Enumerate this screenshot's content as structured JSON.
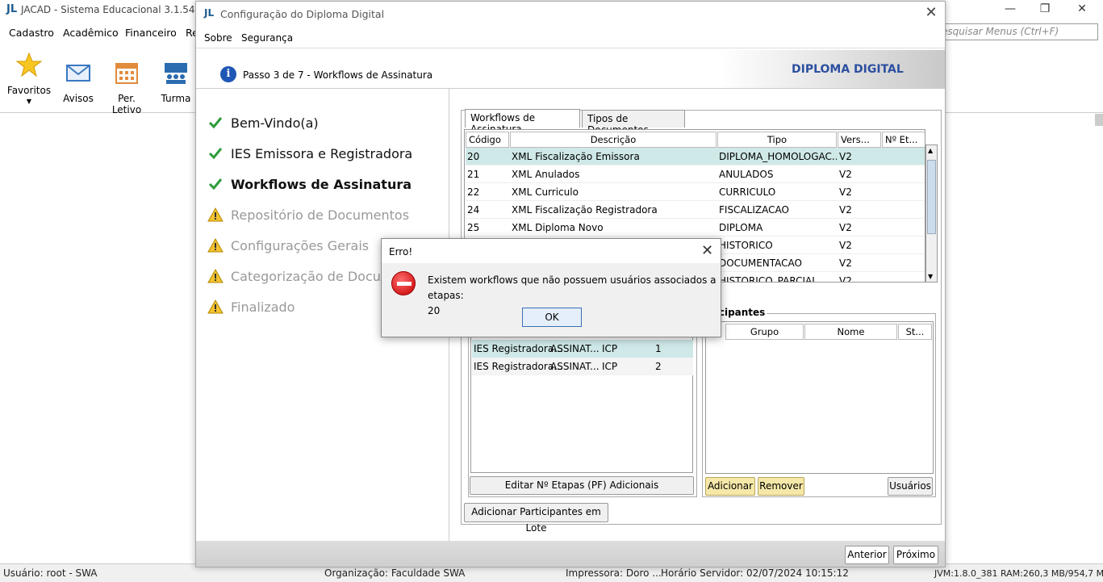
{
  "app": {
    "title": "JACAD - Sistema Educacional 3.1.54",
    "logo": "JL",
    "menu": [
      "Cadastro",
      "Acadêmico",
      "Financeiro",
      "Re"
    ],
    "search_placeholder": "esquisar Menus (Ctrl+F)",
    "toolbar": [
      {
        "label": "Favoritos",
        "icon": "star-icon"
      },
      {
        "label": "Avisos",
        "icon": "mail-icon"
      },
      {
        "label": "Per. Letivo",
        "icon": "calendar-icon"
      },
      {
        "label": "Turma",
        "icon": "class-icon"
      }
    ],
    "window_controls": {
      "minimize": "—",
      "maximize": "❐",
      "close": "✕"
    }
  },
  "status": {
    "user": "Usuário: root - SWA",
    "org": "Organização: Faculdade SWA",
    "printer": "Impressora: Doro ...",
    "server_time": "Horário Servidor: 02/07/2024 10:15:12",
    "jvm": "JVM:1.8.0_381  RAM:260,3 MB/954,7 MB"
  },
  "dialog": {
    "title": "Configuração do Diploma Digital",
    "logo": "JL",
    "close": "✕",
    "menu": [
      "Sobre",
      "Segurança"
    ],
    "step_text": "Passo 3 de 7 - Workflows de Assinatura",
    "brand": "DIPLOMA DIGITAL",
    "steps": [
      {
        "label": "Bem-Vindo(a)",
        "state": "done"
      },
      {
        "label": "IES Emissora e Registradora",
        "state": "done"
      },
      {
        "label": "Workflows de Assinatura",
        "state": "current"
      },
      {
        "label": "Repositório de Documentos",
        "state": "pending"
      },
      {
        "label": "Configurações Gerais",
        "state": "pending"
      },
      {
        "label": "Categorização de Docume",
        "state": "pending"
      },
      {
        "label": "Finalizado",
        "state": "pending"
      }
    ],
    "tabs": [
      "Workflows de Assinatura",
      "Tipos de Documentos"
    ],
    "workflow_grid": {
      "columns": [
        "Código",
        "Descrição",
        "Tipo",
        "Vers...",
        "Nº Et..."
      ],
      "rows": [
        [
          "20",
          "XML Fiscalização Emissora",
          "DIPLOMA_HOMOLOGAC...",
          "V2",
          ""
        ],
        [
          "21",
          "XML Anulados",
          "ANULADOS",
          "V2",
          ""
        ],
        [
          "22",
          "XML Curriculo",
          "CURRICULO",
          "V2",
          ""
        ],
        [
          "24",
          "XML Fiscalização Registradora",
          "FISCALIZACAO",
          "V2",
          ""
        ],
        [
          "25",
          "XML Diploma Novo",
          "DIPLOMA",
          "V2",
          ""
        ],
        [
          "",
          "",
          "HISTORICO",
          "V2",
          ""
        ],
        [
          "",
          "",
          "DOCUMENTACAO",
          "V2",
          ""
        ],
        [
          "",
          "",
          "HISTORICO_PARCIAL",
          "V2",
          ""
        ]
      ]
    },
    "steps_grid_rows": [
      [
        "IES Registradora...",
        "ASSINAT...",
        "ICP",
        "1"
      ],
      [
        "IES Registradora...",
        "ASSINAT...",
        "ICP",
        "2"
      ]
    ],
    "participants": {
      "legend": "ticipantes",
      "columns": [
        "Grupo",
        "Nome",
        "St..."
      ]
    },
    "buttons": {
      "edit_steps": "Editar Nº Etapas (PF) Adicionais",
      "add": "Adicionar",
      "remove": "Remover",
      "users": "Usuários",
      "add_batch": "Adicionar Participantes em Lote",
      "prev": "Anterior",
      "next": "Próximo"
    }
  },
  "error": {
    "title": "Erro!",
    "close": "✕",
    "message": "Existem workflows que não possuem usuários associados a etapas:",
    "detail": "20",
    "ok": "OK"
  }
}
